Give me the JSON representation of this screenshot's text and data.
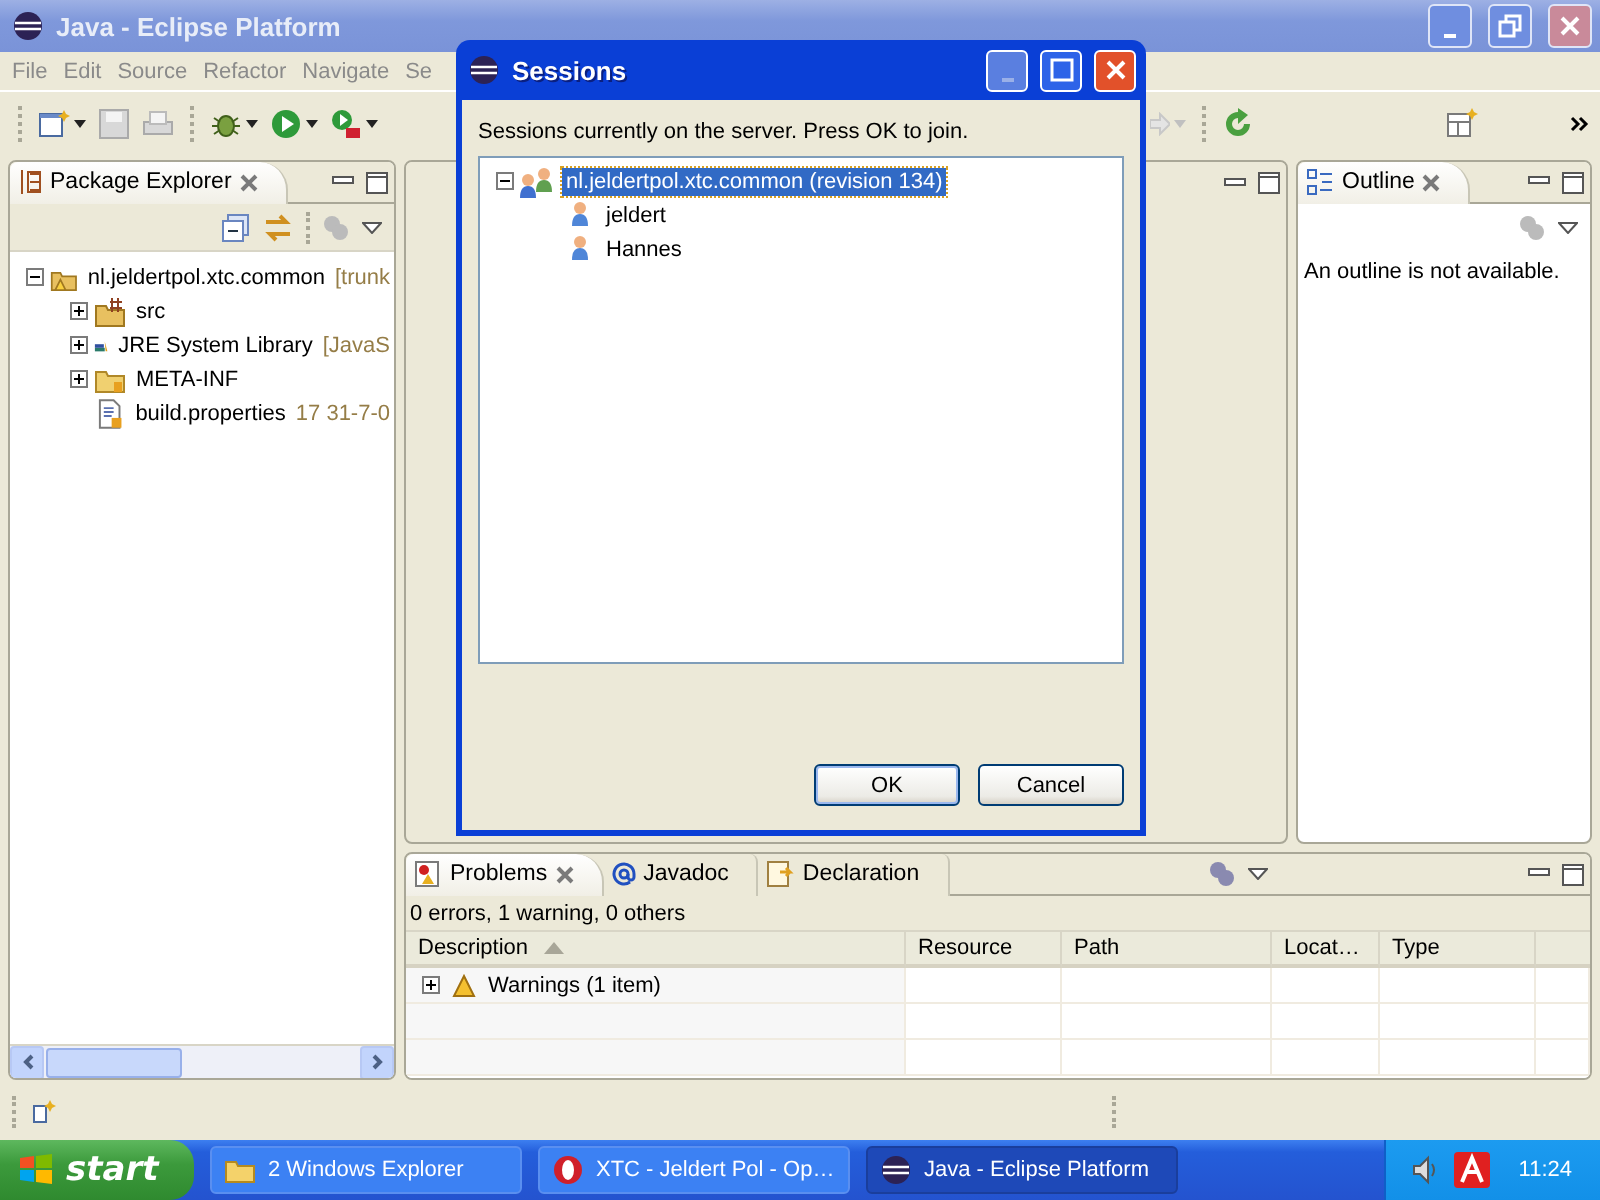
{
  "window": {
    "title": "Java - Eclipse Platform"
  },
  "menu": [
    "File",
    "Edit",
    "Source",
    "Refactor",
    "Navigate",
    "Se"
  ],
  "package_explorer": {
    "title": "Package Explorer",
    "tree": [
      {
        "label": "nl.jeldertpol.xtc.common",
        "decoration": "[trunk",
        "kind": "project",
        "expanded": true,
        "children": [
          {
            "label": "src",
            "kind": "source-folder",
            "expanded": false
          },
          {
            "label": "JRE System Library",
            "decoration": "[JavaS",
            "kind": "library",
            "expanded": false
          },
          {
            "label": "META-INF",
            "kind": "folder",
            "expanded": false
          },
          {
            "label": "build.properties",
            "decoration": "17  31-7-0",
            "kind": "file"
          }
        ]
      }
    ]
  },
  "outline": {
    "title": "Outline",
    "message": "An outline is not available."
  },
  "problems": {
    "tabs": [
      {
        "label": "Problems",
        "selected": true
      },
      {
        "label": "Javadoc",
        "selected": false
      },
      {
        "label": "Declaration",
        "selected": false
      }
    ],
    "summary": "0 errors, 1 warning, 0 others",
    "columns": [
      "Description",
      "Resource",
      "Path",
      "Locat…",
      "Type"
    ],
    "rows": [
      {
        "label": "Warnings (1 item)",
        "expanded": false
      }
    ]
  },
  "dialog": {
    "title": "Sessions",
    "message": "Sessions currently on the server. Press OK to join.",
    "tree": [
      {
        "label": "nl.jeldertpol.xtc.common (revision 134)",
        "kind": "session",
        "selected": true,
        "expanded": true,
        "children": [
          {
            "label": "jeldert",
            "kind": "user",
            "selected": false
          },
          {
            "label": "Hannes",
            "kind": "user",
            "selected": false
          }
        ]
      }
    ],
    "buttons": [
      "OK",
      "Cancel"
    ]
  },
  "taskbar": {
    "start": "start",
    "tasks": [
      {
        "label": "2 Windows Explorer",
        "kind": "folder",
        "selected": false
      },
      {
        "label": "XTC - Jeldert Pol - Op…",
        "kind": "browser",
        "selected": false
      },
      {
        "label": "Java - Eclipse Platform",
        "kind": "eclipse",
        "selected": true
      }
    ],
    "clock": "11:24"
  }
}
